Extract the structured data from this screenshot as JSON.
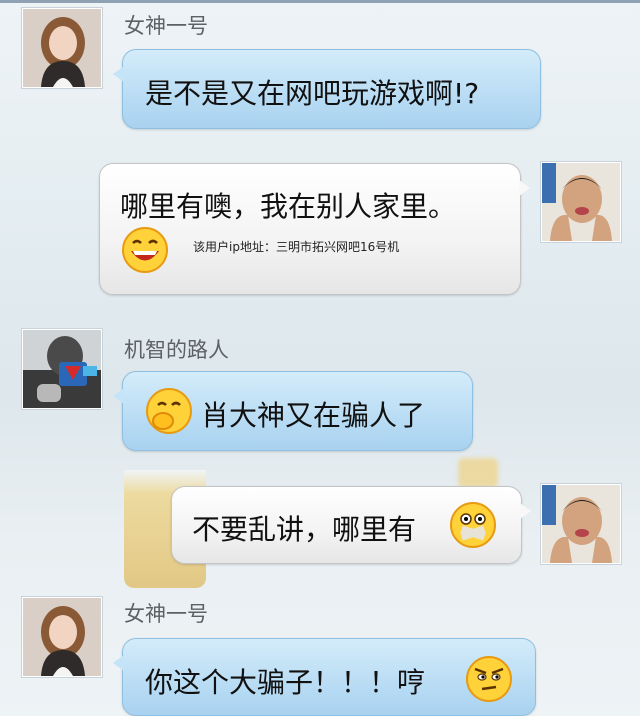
{
  "chat": {
    "messages": [
      {
        "sender": "女神一号",
        "side": "left",
        "text": "是不是又在网吧玩游戏啊!?",
        "avatar": "girl-avatar"
      },
      {
        "sender": "",
        "side": "right",
        "text": "哪里有噢，我在别人家里。",
        "note": "该用户ip地址：三明市拓兴网吧16号机",
        "emoji": "grin-emoji",
        "avatar": "boy-avatar"
      },
      {
        "sender": "机智的路人",
        "side": "left",
        "text": "肖大神又在骗人了",
        "emoji": "snicker-emoji",
        "avatar": "passerby-avatar"
      },
      {
        "sender": "",
        "side": "right",
        "text": "不要乱讲，哪里有",
        "emoji": "taped-mouth-emoji",
        "avatar": "boy-avatar"
      },
      {
        "sender": "女神一号",
        "side": "left",
        "text": "你这个大骗子！！！哼",
        "emoji": "angry-emoji",
        "avatar": "girl-avatar"
      }
    ]
  },
  "colors": {
    "bubble_blue": "#b9dcf4",
    "bubble_gray": "#f3f3f3",
    "name_text": "#5d6166"
  }
}
